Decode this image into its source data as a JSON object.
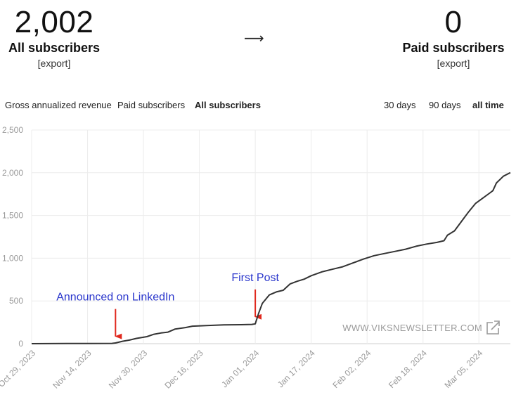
{
  "stats": {
    "all": {
      "value": "2,002",
      "label": "All subscribers",
      "export": "[export]"
    },
    "arrow": "⟶",
    "paid": {
      "value": "0",
      "label": "Paid subscribers",
      "export": "[export]"
    }
  },
  "metric_tabs": [
    "Gross annualized revenue",
    "Paid subscribers",
    "All subscribers"
  ],
  "metric_active": "All subscribers",
  "range_tabs": [
    "30 days",
    "90 days",
    "all time"
  ],
  "range_active": "all time",
  "watermark": "WWW.VIKSNEWSLETTER.COM",
  "colors": {
    "line": "#333333",
    "annotation_text": "#2a36cc",
    "arrow": "#e0281d",
    "grid": "#ececec",
    "tick": "#9a9a9a"
  },
  "chart_data": {
    "type": "line",
    "title": "",
    "xlabel": "",
    "ylabel": "",
    "ylim": [
      0,
      2500
    ],
    "yticks": [
      0,
      500,
      1000,
      1500,
      2000,
      2500
    ],
    "ytick_labels": [
      "0",
      "500",
      "1,000",
      "1,500",
      "2,000",
      "2,500"
    ],
    "xticks": [
      "2023-10-29",
      "2023-11-14",
      "2023-11-30",
      "2023-12-16",
      "2024-01-01",
      "2024-01-17",
      "2024-02-02",
      "2024-02-18",
      "2024-03-05"
    ],
    "xtick_labels": [
      "Oct 29, 2023",
      "Nov 14, 2023",
      "Nov 30, 2023",
      "Dec 16, 2023",
      "Jan 01, 2024",
      "Jan 17, 2024",
      "Feb 02, 2024",
      "Feb 18, 2024",
      "Mar 05, 2024"
    ],
    "xlim": [
      "2023-10-29",
      "2024-03-14"
    ],
    "grid": true,
    "series": [
      {
        "points": [
          [
            "2023-10-29",
            0
          ],
          [
            "2023-11-08",
            2
          ],
          [
            "2023-11-21",
            3
          ],
          [
            "2023-11-22",
            8
          ],
          [
            "2023-11-24",
            28
          ],
          [
            "2023-11-26",
            42
          ],
          [
            "2023-11-28",
            62
          ],
          [
            "2023-12-01",
            82
          ],
          [
            "2023-12-03",
            110
          ],
          [
            "2023-12-05",
            125
          ],
          [
            "2023-12-07",
            135
          ],
          [
            "2023-12-09",
            170
          ],
          [
            "2023-12-12",
            188
          ],
          [
            "2023-12-14",
            205
          ],
          [
            "2023-12-18",
            212
          ],
          [
            "2023-12-23",
            220
          ],
          [
            "2023-12-28",
            222
          ],
          [
            "2023-12-31",
            225
          ],
          [
            "2024-01-01",
            232
          ],
          [
            "2024-01-02",
            360
          ],
          [
            "2024-01-03",
            470
          ],
          [
            "2024-01-05",
            570
          ],
          [
            "2024-01-07",
            605
          ],
          [
            "2024-01-09",
            625
          ],
          [
            "2024-01-11",
            700
          ],
          [
            "2024-01-13",
            730
          ],
          [
            "2024-01-15",
            755
          ],
          [
            "2024-01-17",
            795
          ],
          [
            "2024-01-20",
            840
          ],
          [
            "2024-01-23",
            870
          ],
          [
            "2024-01-26",
            900
          ],
          [
            "2024-01-29",
            945
          ],
          [
            "2024-02-01",
            990
          ],
          [
            "2024-02-04",
            1030
          ],
          [
            "2024-02-07",
            1055
          ],
          [
            "2024-02-10",
            1080
          ],
          [
            "2024-02-13",
            1105
          ],
          [
            "2024-02-16",
            1140
          ],
          [
            "2024-02-19",
            1165
          ],
          [
            "2024-02-22",
            1185
          ],
          [
            "2024-02-24",
            1205
          ],
          [
            "2024-02-25",
            1270
          ],
          [
            "2024-02-27",
            1320
          ],
          [
            "2024-02-29",
            1430
          ],
          [
            "2024-03-02",
            1540
          ],
          [
            "2024-03-04",
            1640
          ],
          [
            "2024-03-06",
            1700
          ],
          [
            "2024-03-08",
            1760
          ],
          [
            "2024-03-09",
            1790
          ],
          [
            "2024-03-10",
            1880
          ],
          [
            "2024-03-12",
            1960
          ],
          [
            "2024-03-14",
            2002
          ]
        ]
      }
    ],
    "annotations": [
      {
        "text": "Announced on LinkedIn",
        "date": "2023-11-22",
        "value": 3
      },
      {
        "text": "First Post",
        "date": "2024-01-01",
        "value": 232
      }
    ]
  }
}
